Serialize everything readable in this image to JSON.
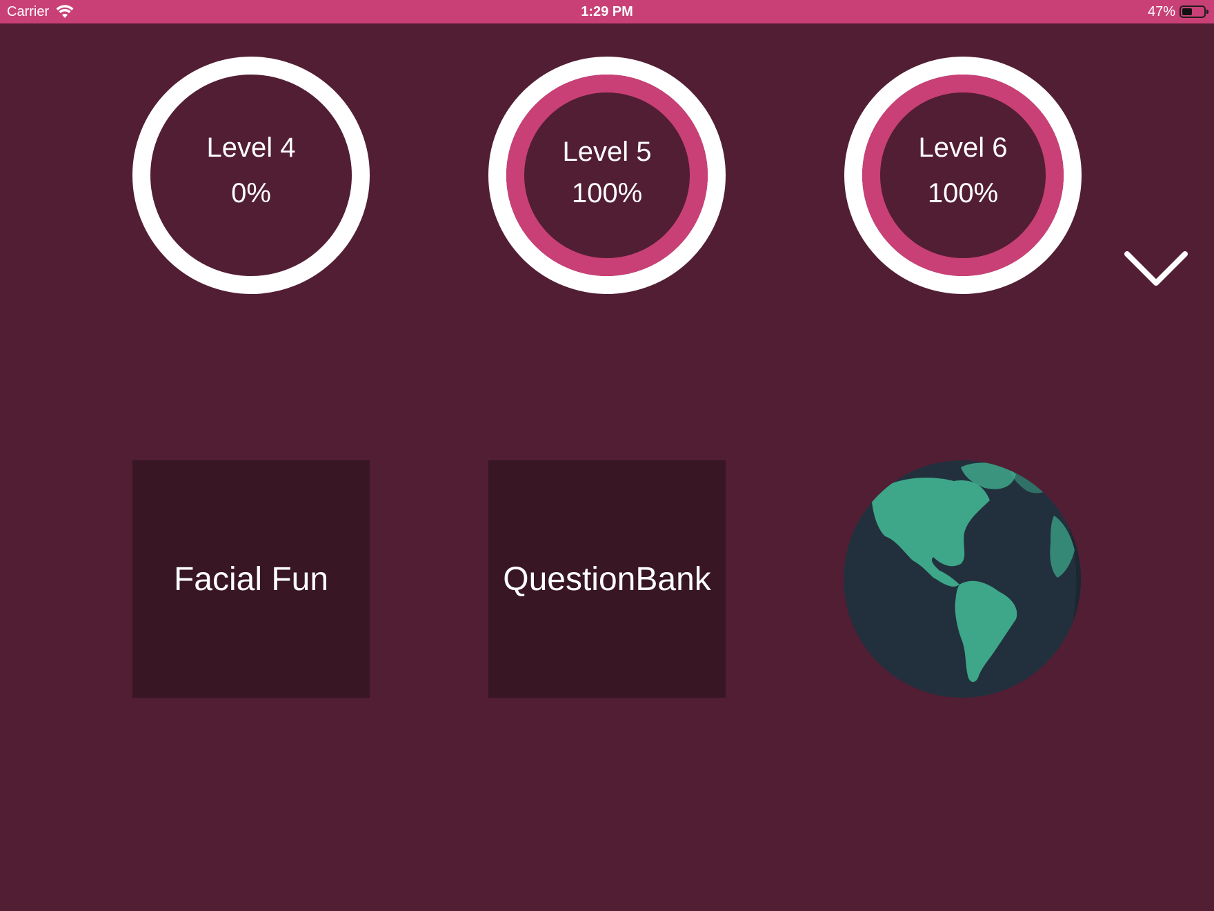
{
  "status_bar": {
    "carrier": "Carrier",
    "time": "1:29 PM",
    "battery": "47%"
  },
  "levels": [
    {
      "title": "Level 4",
      "percent": "0%",
      "progress": 0
    },
    {
      "title": "Level 5",
      "percent": "100%",
      "progress": 1
    },
    {
      "title": "Level 6",
      "percent": "100%",
      "progress": 1
    }
  ],
  "tiles": {
    "facial_fun": "Facial Fun",
    "question_bank": "QuestionBank"
  },
  "colors": {
    "background": "#521e33",
    "accent": "#c94076",
    "tile": "#381624",
    "globe_ocean": "#22303d",
    "globe_land": "#3ea689"
  },
  "icons": [
    "wifi-icon",
    "battery-icon",
    "chevron-down-icon",
    "globe-icon"
  ]
}
